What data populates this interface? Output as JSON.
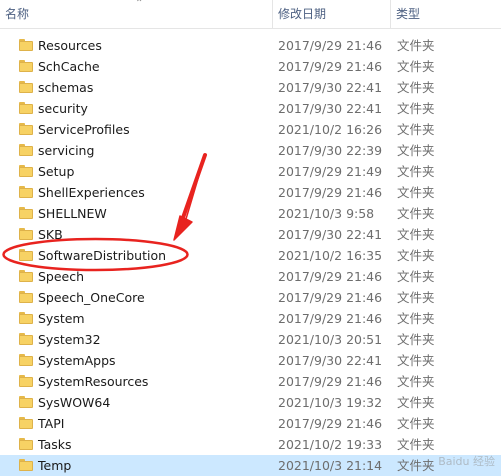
{
  "header": {
    "name_label": "名称",
    "date_label": "修改日期",
    "type_label": "类型",
    "sort_icon": "chevron-up-icon"
  },
  "rows": [
    {
      "name": "Resources",
      "date": "2017/9/29 21:46",
      "type": "文件夹"
    },
    {
      "name": "SchCache",
      "date": "2017/9/29 21:46",
      "type": "文件夹"
    },
    {
      "name": "schemas",
      "date": "2017/9/30 22:41",
      "type": "文件夹"
    },
    {
      "name": "security",
      "date": "2017/9/30 22:41",
      "type": "文件夹"
    },
    {
      "name": "ServiceProfiles",
      "date": "2021/10/2 16:26",
      "type": "文件夹"
    },
    {
      "name": "servicing",
      "date": "2017/9/30 22:39",
      "type": "文件夹"
    },
    {
      "name": "Setup",
      "date": "2017/9/29 21:49",
      "type": "文件夹"
    },
    {
      "name": "ShellExperiences",
      "date": "2017/9/29 21:46",
      "type": "文件夹"
    },
    {
      "name": "SHELLNEW",
      "date": "2021/10/3 9:58",
      "type": "文件夹"
    },
    {
      "name": "SKB",
      "date": "2017/9/30 22:41",
      "type": "文件夹"
    },
    {
      "name": "SoftwareDistribution",
      "date": "2021/10/2 16:35",
      "type": "文件夹"
    },
    {
      "name": "Speech",
      "date": "2017/9/29 21:46",
      "type": "文件夹"
    },
    {
      "name": "Speech_OneCore",
      "date": "2017/9/29 21:46",
      "type": "文件夹"
    },
    {
      "name": "System",
      "date": "2017/9/29 21:46",
      "type": "文件夹"
    },
    {
      "name": "System32",
      "date": "2021/10/3 20:51",
      "type": "文件夹"
    },
    {
      "name": "SystemApps",
      "date": "2017/9/30 22:41",
      "type": "文件夹"
    },
    {
      "name": "SystemResources",
      "date": "2017/9/29 21:46",
      "type": "文件夹"
    },
    {
      "name": "SysWOW64",
      "date": "2021/10/3 19:32",
      "type": "文件夹"
    },
    {
      "name": "TAPI",
      "date": "2017/9/29 21:46",
      "type": "文件夹"
    },
    {
      "name": "Tasks",
      "date": "2021/10/2 19:33",
      "type": "文件夹"
    },
    {
      "name": "Temp",
      "date": "2021/10/3 21:14",
      "type": "文件夹"
    }
  ],
  "selected_row": "Temp",
  "watermark": "Baidu 经验",
  "colors": {
    "selection": "#cce8ff",
    "folder": "#f7d264",
    "annotation_red": "#e8231f",
    "header_text": "#4d6082"
  }
}
